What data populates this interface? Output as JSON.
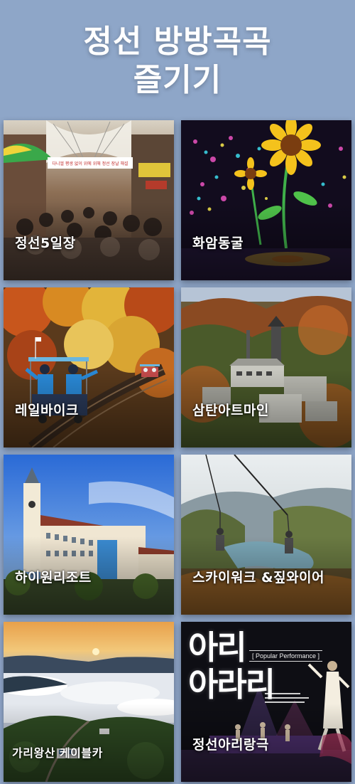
{
  "header": {
    "title_line1": "정선 방방곡곡",
    "title_line2": "즐기기"
  },
  "tiles": [
    {
      "label": "정선5일장"
    },
    {
      "label": "화암동굴"
    },
    {
      "label": "레일바이크"
    },
    {
      "label": "삼탄아트마인"
    },
    {
      "label": "하이원리조트"
    },
    {
      "label": "스카이워크 &짚와이어"
    },
    {
      "label": "가리왕산 케이블카"
    },
    {
      "label": "정선아리랑극"
    }
  ],
  "poster": {
    "brand_line1": "아리",
    "brand_line2": "아라리",
    "tag": "[ Popular Performance ]"
  },
  "market_banner": "다니엘 평생 없이 위에 위해 정선 장날 해설",
  "colors": {
    "background": "#8fa6c9",
    "title": "#ffffff"
  }
}
